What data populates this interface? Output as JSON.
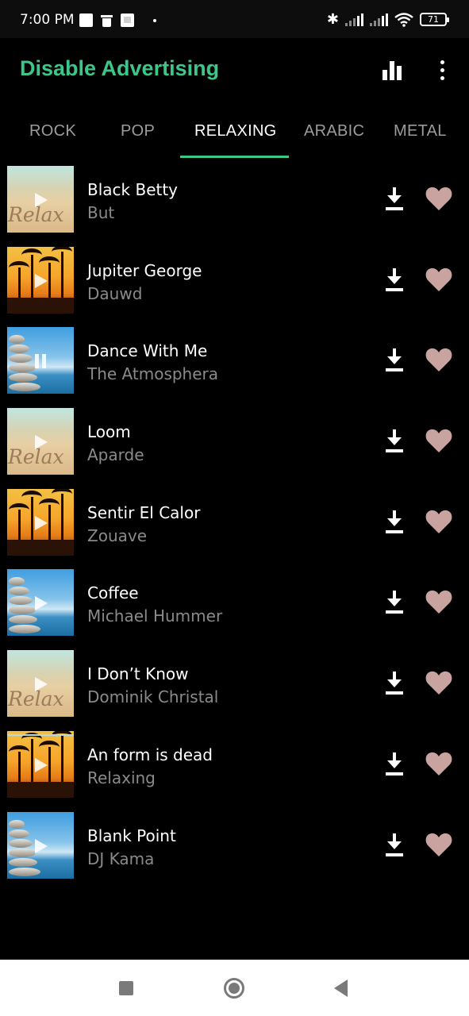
{
  "status_bar": {
    "time": "7:00 PM",
    "battery": "71",
    "icons": [
      "notification-icon",
      "trash-icon",
      "image-icon",
      "dot-icon",
      "bluetooth-icon",
      "signal-icon",
      "signal-icon",
      "wifi-icon",
      "battery-icon"
    ]
  },
  "app_bar": {
    "title": "Disable Advertising",
    "title_color": "#3cc68a",
    "actions": [
      "equalizer-icon",
      "more-vert-icon"
    ]
  },
  "tabs": [
    {
      "label": "ROCK",
      "active": false
    },
    {
      "label": "POP",
      "active": false
    },
    {
      "label": "RELAXING",
      "active": true
    },
    {
      "label": "ARABIC",
      "active": false
    },
    {
      "label": "METAL",
      "active": false
    }
  ],
  "accent_color": "#3cc68a",
  "heart_color": "#c9a39f",
  "songs": [
    {
      "title": "Black Betty",
      "artist": "But",
      "art": "sand",
      "art_text": "Relax",
      "state": "play"
    },
    {
      "title": "Jupiter George",
      "artist": "Dauwd",
      "art": "palms",
      "state": "play"
    },
    {
      "title": "Dance With Me",
      "artist": "The Atmosphera",
      "art": "stones",
      "state": "pause"
    },
    {
      "title": "Loom",
      "artist": "Aparde",
      "art": "sand",
      "art_text": "Relax",
      "state": "play"
    },
    {
      "title": "Sentir El Calor",
      "artist": "Zouave",
      "art": "palms",
      "state": "play"
    },
    {
      "title": "Coffee",
      "artist": "Michael Hummer",
      "art": "stones",
      "state": "play"
    },
    {
      "title": "I Don’t Know",
      "artist": "Dominik Christal",
      "art": "sand",
      "art_text": "Relax",
      "state": "play"
    },
    {
      "title": "An form is dead",
      "artist": "Relaxing",
      "art": "palms",
      "state": "play"
    },
    {
      "title": "Blank Point",
      "artist": "DJ Kama",
      "art": "stones",
      "state": "play"
    }
  ],
  "nav_bar": [
    "recent-apps-icon",
    "home-icon",
    "back-icon"
  ]
}
